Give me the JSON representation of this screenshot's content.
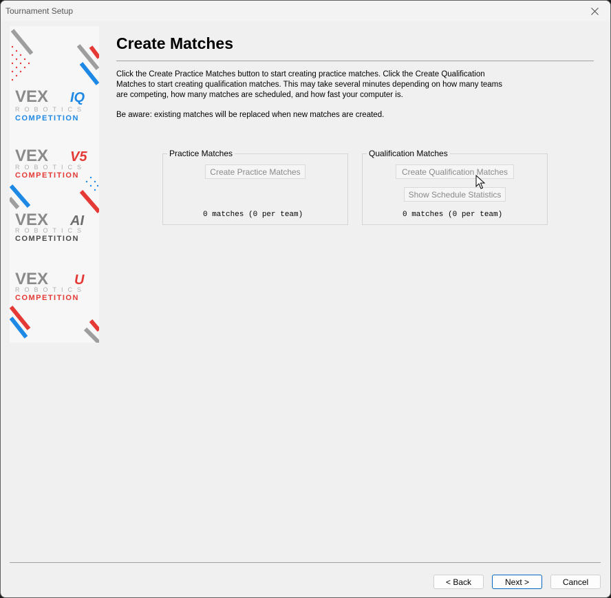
{
  "window": {
    "title": "Tournament Setup"
  },
  "banner": {
    "logos": [
      {
        "brand": "VEX",
        "product": "IQ",
        "sub": "ROBOTICS",
        "caption": "COMPETITION"
      },
      {
        "brand": "VEX",
        "product": "V5",
        "sub": "ROBOTICS",
        "caption": "COMPETITION"
      },
      {
        "brand": "VEX",
        "product": "AI",
        "sub": "ROBOTICS",
        "caption": "COMPETITION"
      },
      {
        "brand": "VEX",
        "product": "U",
        "sub": "ROBOTICS",
        "caption": "COMPETITION"
      }
    ]
  },
  "page": {
    "title": "Create Matches",
    "description_lines": [
      "Click the Create Practice Matches button to start creating practice matches.  Click the Create Qualification",
      "Matches to start creating qualification matches.  This may take several minutes depending on how many teams",
      "are competing, how many matches are scheduled, and how fast your computer is."
    ],
    "warning": "Be aware: existing matches will be replaced when new matches are created."
  },
  "practice": {
    "label": "Practice Matches",
    "create_button": "Create Practice Matches",
    "count_text": "0 matches (0 per team)"
  },
  "qualification": {
    "label": "Qualification Matches",
    "create_button": "Create Qualification Matches",
    "stats_button": "Show Schedule Statistics",
    "count_text": "0 matches (0 per team)"
  },
  "footer": {
    "back": "< Back",
    "next": "Next >",
    "cancel": "Cancel"
  },
  "colors": {
    "vex_blue": "#1e88e5",
    "vex_red": "#e53935",
    "vex_gray": "#757575",
    "accent": "#0067c0"
  }
}
